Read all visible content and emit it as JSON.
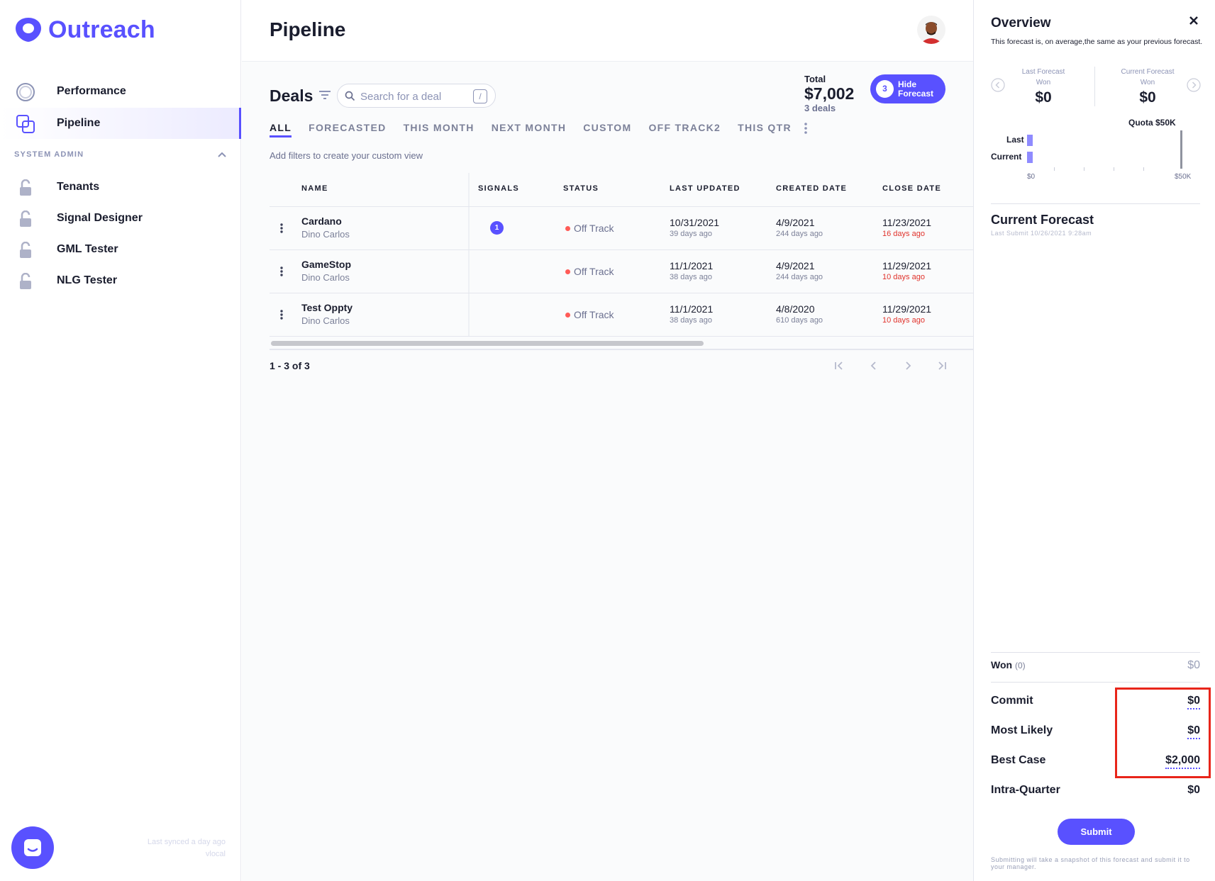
{
  "app": {
    "brand": "Outreach",
    "accent": "#5951ff",
    "danger": "#ff5b57"
  },
  "sidebar": {
    "items": [
      {
        "label": "Performance",
        "icon": "performance-ring-icon"
      },
      {
        "label": "Pipeline",
        "icon": "pipeline-squares-icon",
        "active": true
      }
    ],
    "section_label": "SYSTEM ADMIN",
    "admin_items": [
      {
        "label": "Tenants",
        "icon": "lock-open-icon"
      },
      {
        "label": "Signal Designer",
        "icon": "lock-open-icon"
      },
      {
        "label": "GML Tester",
        "icon": "lock-open-icon"
      },
      {
        "label": "NLG Tester",
        "icon": "lock-open-icon"
      }
    ],
    "sync_text": "Last synced a day ago",
    "sync_user": "vlocal"
  },
  "header": {
    "title": "Pipeline"
  },
  "deals": {
    "title": "Deals",
    "search_placeholder": "Search for a deal",
    "search_shortcut": "/",
    "total_label": "Total",
    "total_value": "$7,002",
    "total_count": "3 deals",
    "hide_forecast_count": "3",
    "hide_forecast_label": "Hide Forecast",
    "tabs": [
      "ALL",
      "FORECASTED",
      "THIS MONTH",
      "NEXT MONTH",
      "CUSTOM",
      "OFF TRACK2",
      "THIS QTR"
    ],
    "hint": "Add filters to create your custom view",
    "columns": [
      "NAME",
      "SIGNALS",
      "STATUS",
      "LAST UPDATED",
      "CREATED DATE",
      "CLOSE DATE"
    ],
    "rows": [
      {
        "name": "Cardano",
        "owner": "Dino Carlos",
        "signals": "1",
        "status": "Off Track",
        "last_updated": "10/31/2021",
        "last_updated_ago": "39 days ago",
        "created": "4/9/2021",
        "created_ago": "244 days ago",
        "close": "11/23/2021",
        "close_ago": "16 days ago"
      },
      {
        "name": "GameStop",
        "owner": "Dino Carlos",
        "signals": "",
        "status": "Off Track",
        "last_updated": "11/1/2021",
        "last_updated_ago": "38 days ago",
        "created": "4/9/2021",
        "created_ago": "244 days ago",
        "close": "11/29/2021",
        "close_ago": "10 days ago"
      },
      {
        "name": "Test Oppty",
        "owner": "Dino Carlos",
        "signals": "",
        "status": "Off Track",
        "last_updated": "11/1/2021",
        "last_updated_ago": "38 days ago",
        "created": "4/8/2020",
        "created_ago": "610 days ago",
        "close": "11/29/2021",
        "close_ago": "10 days ago"
      }
    ],
    "pager": "1 - 3 of 3"
  },
  "panel": {
    "title": "Overview",
    "description": "This forecast is, on average,the same as your previous forecast.",
    "last_forecast_label": "Last Forecast",
    "current_forecast_label": "Current Forecast",
    "won_label": "Won",
    "last_won": "$0",
    "current_won": "$0",
    "quota": "Quota $50K",
    "bar_last": "Last",
    "bar_current": "Current",
    "axis_min": "$0",
    "axis_max": "$50K",
    "current_forecast_title": "Current Forecast",
    "last_submit": "Last Submit 10/26/2021 9:28am",
    "won_row_label": "Won",
    "won_row_count": "(0)",
    "won_row_value": "$0",
    "commit_label": "Commit",
    "commit_value": "$0",
    "most_likely_label": "Most Likely",
    "most_likely_value": "$0",
    "best_case_label": "Best Case",
    "best_case_value": "$2,000",
    "intra_quarter_label": "Intra-Quarter",
    "intra_quarter_value": "$0",
    "submit_label": "Submit",
    "submit_note": "Submitting will take a snapshot of this forecast and submit it to your manager."
  }
}
